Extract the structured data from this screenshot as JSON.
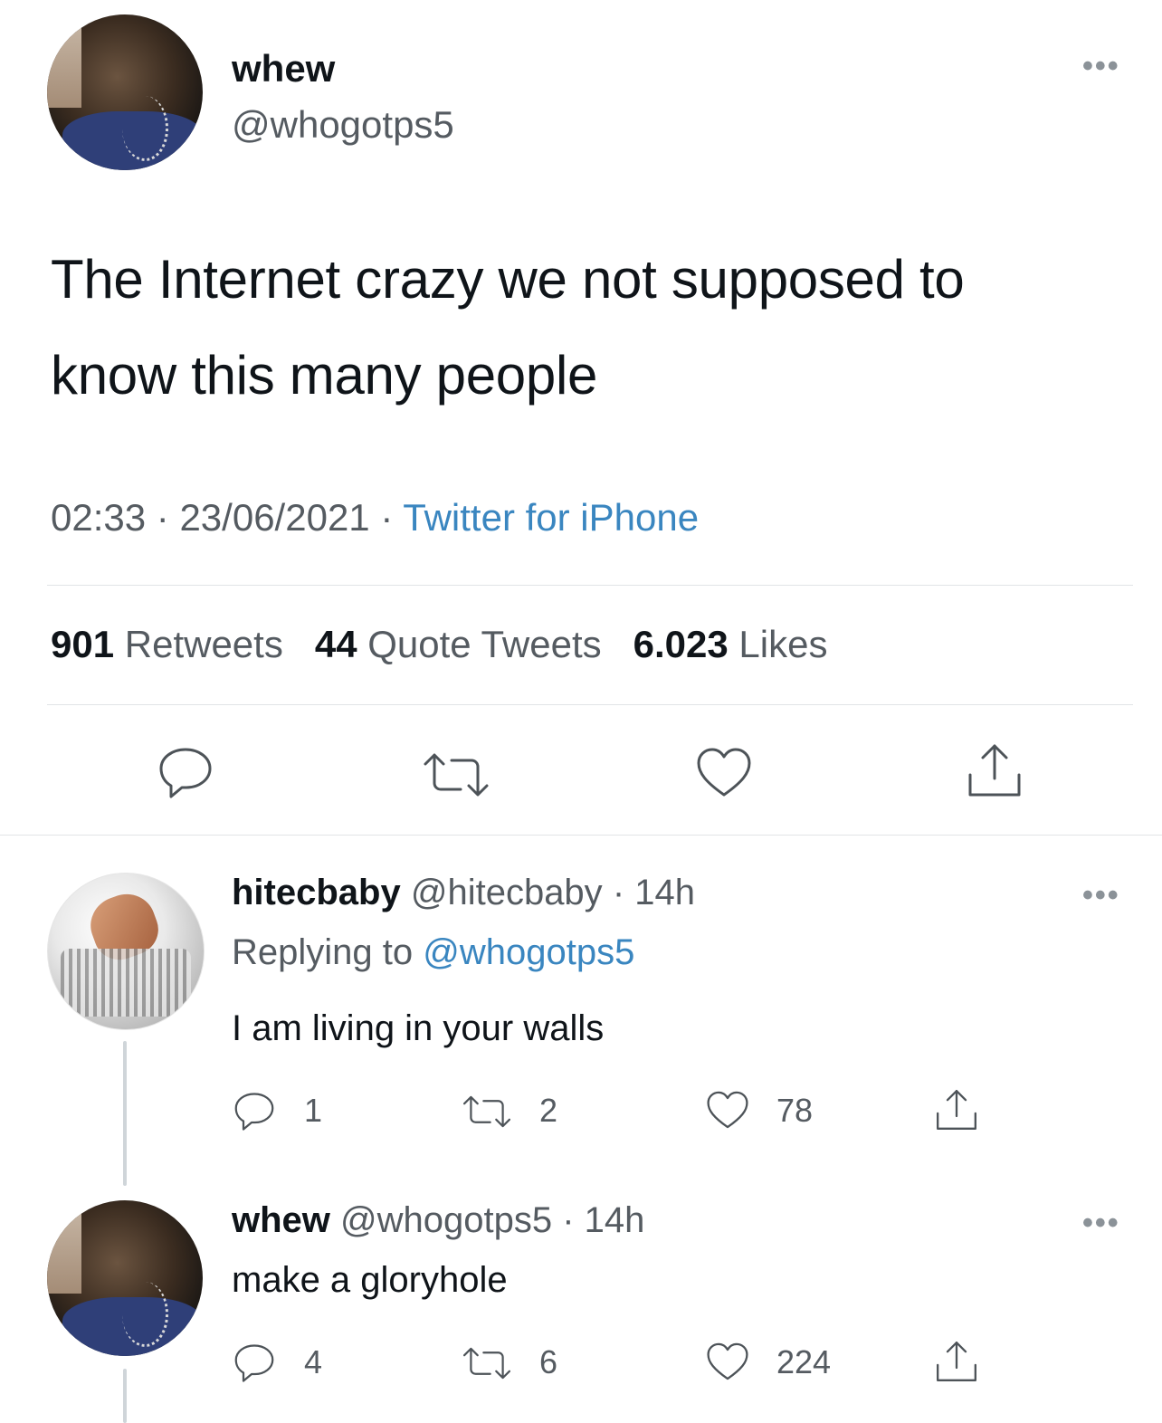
{
  "main_tweet": {
    "author_name": "whew",
    "author_handle": "@whogotps5",
    "text_line1": "The Internet crazy we not supposed to",
    "text_line2": "know this many people",
    "time": "02:33",
    "date": "23/06/2021",
    "source": "Twitter for iPhone",
    "separator": "·",
    "retweets_count": "901",
    "retweets_label": "Retweets",
    "quotes_count": "44",
    "quotes_label": "Quote Tweets",
    "likes_count": "6.023",
    "likes_label": "Likes",
    "more_label": "•••"
  },
  "replies": [
    {
      "author_name": "hitecbaby",
      "author_handle": "@hitecbaby",
      "time": "· 14h",
      "replying_prefix": "Replying to",
      "replying_handle": "@whogotps5",
      "text": "I am living in your walls",
      "reply_count": "1",
      "retweet_count": "2",
      "like_count": "78",
      "more_label": "•••"
    },
    {
      "author_name": "whew",
      "author_handle": "@whogotps5",
      "time": "· 14h",
      "text": "make a gloryhole",
      "reply_count": "4",
      "retweet_count": "6",
      "like_count": "224",
      "more_label": "•••"
    }
  ],
  "icons": [
    "reply-icon",
    "retweet-icon",
    "like-icon",
    "share-icon",
    "more-icon"
  ],
  "colors": {
    "link": "#3a86c0",
    "text": "#0f1419",
    "secondary": "#555b61",
    "divider": "#e1e4e6"
  }
}
